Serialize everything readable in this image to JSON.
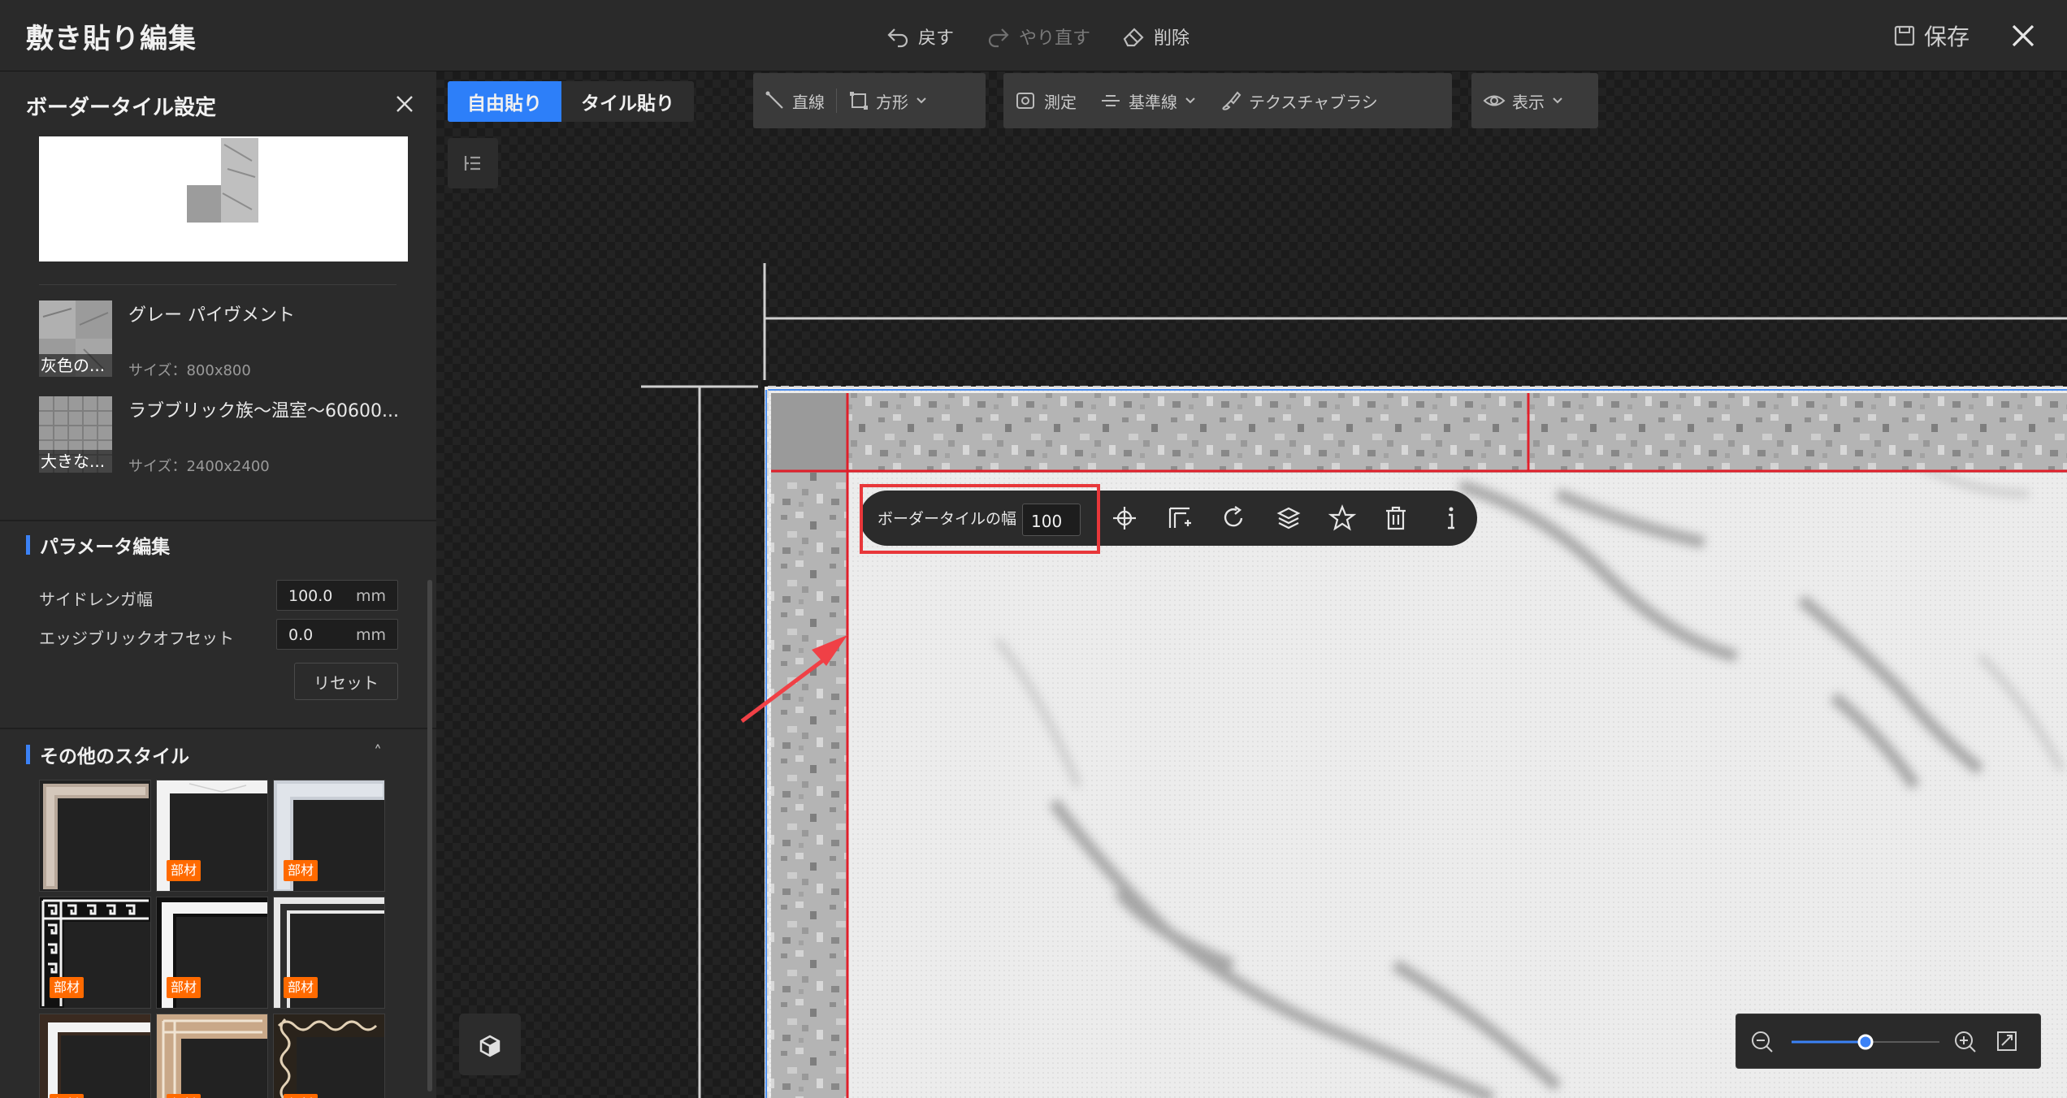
{
  "header": {
    "title": "敷き貼り編集",
    "undo_label": "戻す",
    "redo_label": "やり直す",
    "delete_label": "削除",
    "save_label": "保存"
  },
  "panel": {
    "title": "ボーダータイル設定",
    "materials": [
      {
        "name": "グレー パイヴメント",
        "caption": "灰色の...",
        "size": "サイズ：800x800"
      },
      {
        "name": "ラブブリック族～温室～60600...",
        "caption": "大きな...",
        "size": "サイズ：2400x2400"
      }
    ],
    "params_title": "パラメータ編集",
    "params": [
      {
        "label": "サイドレンガ幅",
        "value": "100.0",
        "unit": "mm"
      },
      {
        "label": "エッジブリックオフセット",
        "value": "0.0",
        "unit": "mm"
      }
    ],
    "reset_label": "リセット",
    "other_styles_title": "その他のスタイル",
    "style_badge": "部材"
  },
  "canvas": {
    "mode_tabs": [
      "自由貼り",
      "タイル貼り"
    ],
    "active_mode": "自由貼り",
    "tools": {
      "line": "直線",
      "rect": "方形",
      "measure": "測定",
      "baseline": "基準線",
      "texture_brush": "テクスチャブラシ",
      "display": "表示"
    },
    "context_toolbar": {
      "label": "ボーダータイルの幅",
      "value": "100"
    },
    "zoom_level": 0.5
  },
  "colors": {
    "accent": "#2d7ff9",
    "badge": "#ff6a00",
    "highlight": "#e8373a",
    "tile_border": "#e01f2a"
  }
}
